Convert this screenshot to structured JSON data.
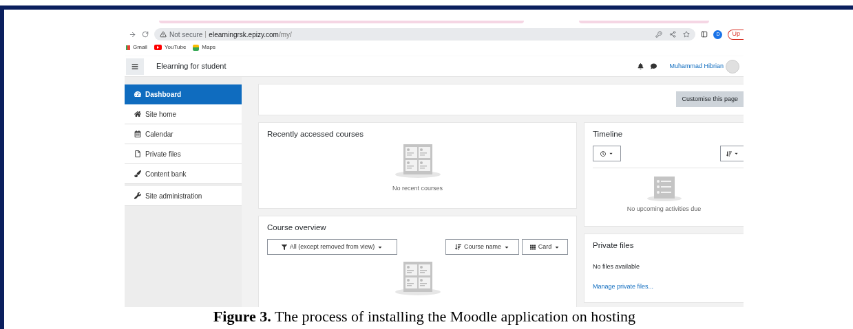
{
  "browser": {
    "security_label": "Not secure",
    "host": "elearningrsk.epizy.com",
    "path": "/my/",
    "profile_initial": "D",
    "update_label": "Up"
  },
  "bookmarks": [
    "Gmail",
    "YouTube",
    "Maps"
  ],
  "navbar": {
    "title": "Elearning for student",
    "user_name": "Muhammad Hibrian"
  },
  "sidebar": {
    "groups": [
      {
        "items": [
          {
            "label": "Dashboard",
            "selected": true
          },
          {
            "label": "Site home",
            "selected": false
          },
          {
            "label": "Calendar",
            "selected": false
          },
          {
            "label": "Private files",
            "selected": false
          },
          {
            "label": "Content bank",
            "selected": false
          }
        ]
      },
      {
        "items": [
          {
            "label": "Site administration",
            "selected": false
          }
        ]
      }
    ]
  },
  "customise_button": "Customise this page",
  "recent_courses": {
    "title": "Recently accessed courses",
    "empty_text": "No recent courses"
  },
  "course_overview": {
    "title": "Course overview",
    "filter": "All (except removed from view)",
    "sort": "Course name",
    "view": "Card"
  },
  "timeline": {
    "title": "Timeline",
    "empty_text": "No upcoming activities due"
  },
  "private_files": {
    "title": "Private files",
    "empty_text": "No files available",
    "link": "Manage private files..."
  },
  "caption": "**Figure 3.** The process of installing the Moodle application on hosting"
}
